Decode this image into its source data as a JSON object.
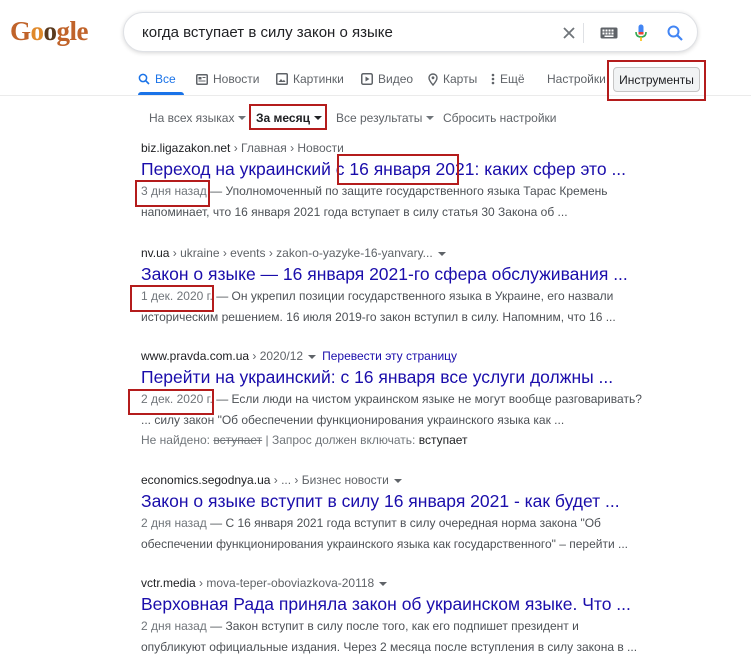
{
  "header": {
    "logo_letters": [
      {
        "ch": "G",
        "color": "#c0632a"
      },
      {
        "ch": "o",
        "color": "#e0892a"
      },
      {
        "ch": "o",
        "color": "#5a3a1e"
      },
      {
        "ch": "g",
        "color": "#c0632a"
      },
      {
        "ch": "l",
        "color": "#c0632a"
      },
      {
        "ch": "e",
        "color": "#c0632a"
      }
    ],
    "search_value": "когда вступает в силу закон о языке",
    "icons": [
      "close-icon",
      "keyboard-icon",
      "mic-icon",
      "search-icon"
    ]
  },
  "tabs": [
    {
      "label": "Все",
      "icon": "search-icon",
      "active": true
    },
    {
      "label": "Новости",
      "icon": "news-icon"
    },
    {
      "label": "Картинки",
      "icon": "image-icon"
    },
    {
      "label": "Видео",
      "icon": "video-icon"
    },
    {
      "label": "Карты",
      "icon": "map-pin-icon"
    },
    {
      "label": "Ещё",
      "icon": "more-icon"
    },
    {
      "label": "Настройки"
    }
  ],
  "tools_label": "Инструменты",
  "filters": {
    "language": "На всех языках",
    "time": "За месяц",
    "results": "Все результаты",
    "reset": "Сбросить настройки"
  },
  "results": [
    {
      "domain": "biz.ligazakon.net",
      "path": " › Главная › Новости",
      "title": "Переход на украинский с 16 января 2021: каких сфер это ...",
      "date": "3 дня назад",
      "line1": " — Уполномоченный по защите государственного языка Тарас Кремень",
      "line2": "напоминает, что 16 января 2021 года вступает в силу статья 30 Закона об ..."
    },
    {
      "domain": "nv.ua",
      "path": " › ukraine › events › zakon-o-yazyke-16-yanvary...",
      "title": "Закон о языке — 16 января 2021-го сфера обслуживания ...",
      "date": "1 дек. 2020 г.",
      "line1": " — Он укрепил позиции государственного языка в Украине, его назвали",
      "line2": "историческим решением. 16 июля 2019-го закон вступил в силу. Напомним, что 16 ..."
    },
    {
      "domain": "www.pravda.com.ua",
      "path": " › 2020/12",
      "translate": "Перевести эту страницу",
      "title": "Перейти на украинский: с 16 января все услуги должны ...",
      "date": "2 дек. 2020 г.",
      "line1": " — Если люди на чистом украинском языке не могут вообще разговаривать?",
      "line2": "... силу закон \"Об обеспечении функционирования украинского языка как ...",
      "not_found_label": "Не найдено:",
      "not_found_word": "вступает",
      "required_label": "| Запрос должен включать:",
      "required_word": "вступает"
    },
    {
      "domain": "economics.segodnya.ua",
      "path": " › ... › Бизнес новости",
      "title": "Закон о языке вступит в силу 16 января 2021 - как будет ...",
      "date": "2 дня назад",
      "line1": " — С 16 января 2021 года вступит в силу очередная норма закона \"Об",
      "line2": "обеспечении функционирования украинского языка как государственного\" – перейти ..."
    },
    {
      "domain": "vctr.media",
      "path": " › mova-teper-oboviazkova-20118",
      "title": "Верховная Рада приняла закон об украинском языке. Что ...",
      "date": "2 дня назад",
      "line1": " — Закон вступит в силу после того, как его подпишет президент и",
      "line2": "опубликуют официальные издания. Через 2 месяца после вступления в силу закона в ..."
    }
  ]
}
